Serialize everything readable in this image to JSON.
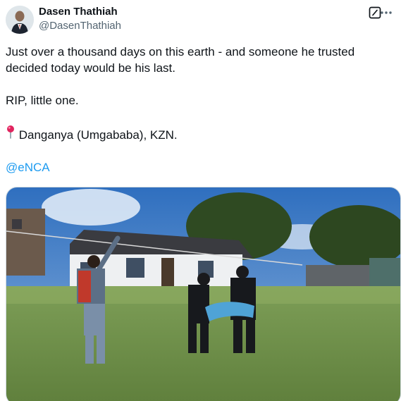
{
  "author": {
    "display_name": "Dasen Thathiah",
    "handle": "@DasenThathiah"
  },
  "header_icons": {
    "grok": "grok-icon",
    "more": "more-icon"
  },
  "tweet": {
    "line1": "Just over a thousand days on this earth - and someone he trusted",
    "line2": "decided today would be his last.",
    "line3": "RIP, little one.",
    "location_icon": "round-pushpin-icon",
    "location": "Danganya (Umgababa), KZN.",
    "mention": "@eNCA"
  },
  "media": {
    "kind": "photo"
  },
  "colors": {
    "text": "#0f1419",
    "secondary": "#536471",
    "link": "#1d9bf0",
    "pin": "#e0245e"
  }
}
